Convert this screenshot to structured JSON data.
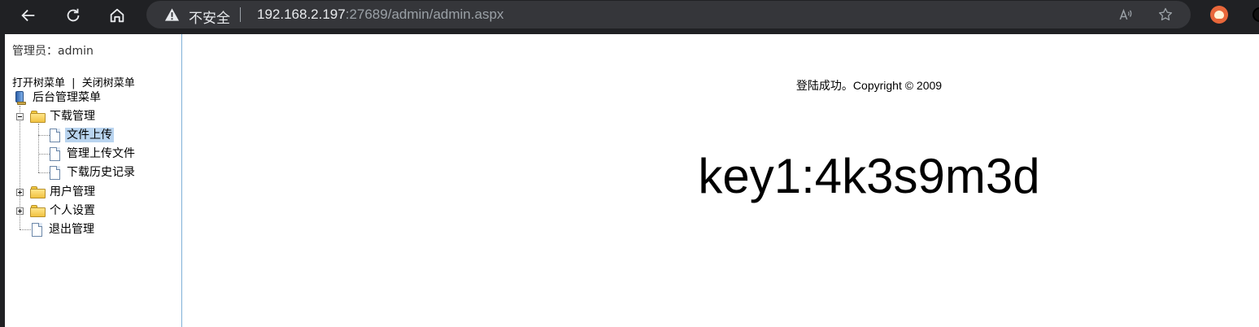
{
  "browser": {
    "address": {
      "security_label": "不安全",
      "url_host": "192.168.2.197",
      "url_rest": ":27689/admin/admin.aspx"
    },
    "icons": [
      "back-arrow-icon",
      "refresh-icon",
      "home-icon",
      "warning-icon",
      "read-aloud-icon",
      "favorite-star-icon",
      "extension-icon"
    ]
  },
  "sidebar": {
    "admin_label": "管理员：admin",
    "open_tree": "打开树菜单",
    "divider": "|",
    "close_tree": "关闭树菜单",
    "tree": {
      "root": "后台管理菜单",
      "download": {
        "label": "下载管理",
        "items": [
          "文件上传",
          "管理上传文件",
          "下载历史记录"
        ]
      },
      "users": "用户管理",
      "settings": "个人设置",
      "logout": "退出管理"
    }
  },
  "main": {
    "copyright": "登陆成功。Copyright © 2009",
    "key": "key1:4k3s9m3d"
  },
  "colors": {
    "browser_chrome": "#202124",
    "address_bar": "#35363a",
    "selected_node": "#b9d4ef",
    "frame_border": "#7fb0d8"
  }
}
